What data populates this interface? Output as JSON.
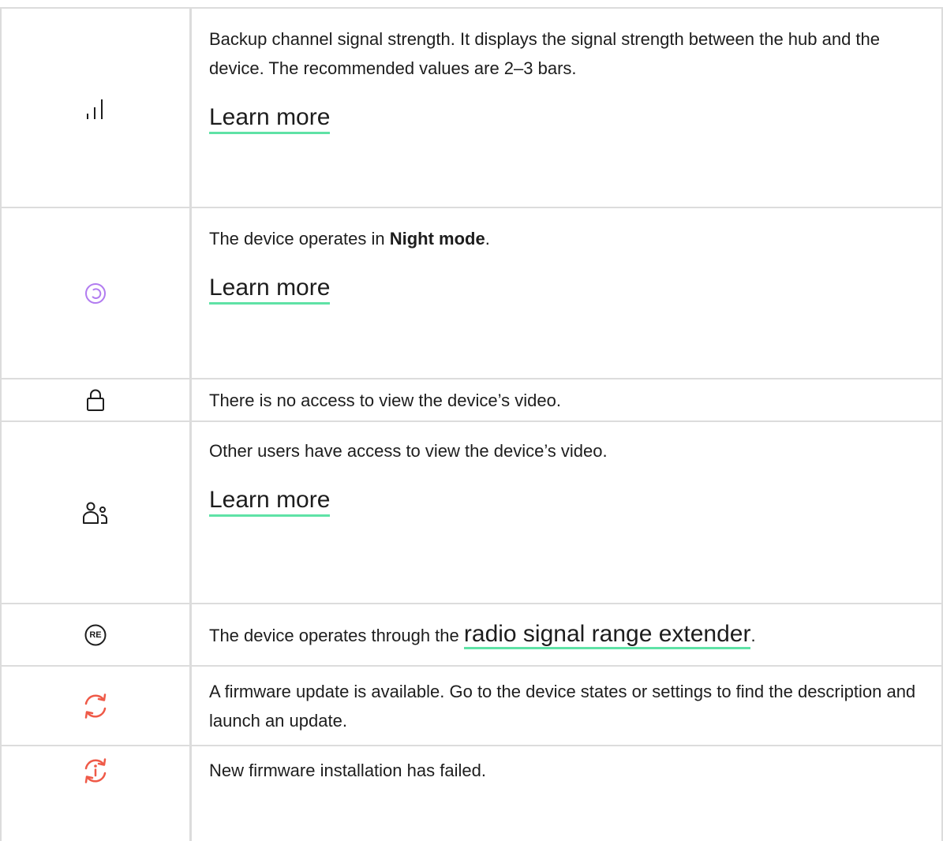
{
  "rows": [
    {
      "icon": "signal-bars-icon",
      "text": "Backup channel signal strength. It displays the signal strength between the hub and the device. The recommended values are 2–3 bars.",
      "link": "Learn more"
    },
    {
      "icon": "night-mode-icon",
      "text_before": "The device operates in ",
      "bold": "Night mode",
      "text_after": ".",
      "link": "Learn more"
    },
    {
      "icon": "lock-icon",
      "text": "There is no access to view the device’s video."
    },
    {
      "icon": "users-icon",
      "text": "Other users have access to view the device’s video.",
      "link": "Learn more"
    },
    {
      "icon": "range-extender-icon",
      "icon_label": "RE",
      "text_before": "The device operates through the ",
      "link": "radio signal range extender",
      "text_after": "."
    },
    {
      "icon": "firmware-update-icon",
      "text": "A firmware update is available. Go to the device states or settings to find the description and launch an update."
    },
    {
      "icon": "firmware-failed-icon",
      "text": "New firmware installation has failed."
    }
  ],
  "colors": {
    "link_underline": "#5fe2a6",
    "night_mode_icon": "#b27cf0",
    "firmware_icon": "#ef5a48",
    "border": "#dcdcdc"
  }
}
